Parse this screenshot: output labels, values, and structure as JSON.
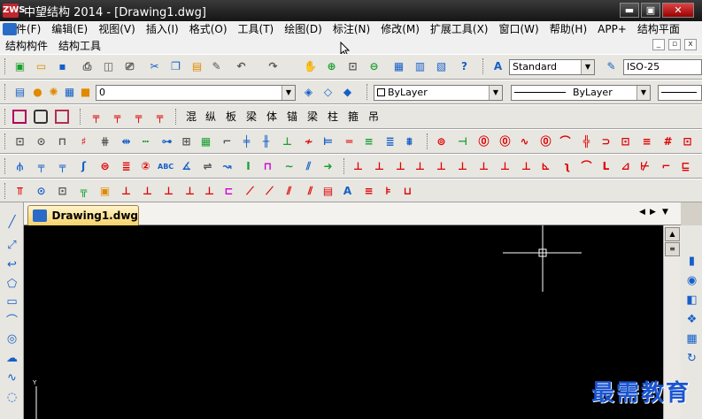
{
  "window": {
    "title": "中望结构 2014 - [Drawing1.dwg]",
    "logo_text": "ZWS",
    "min_label": "▬",
    "restore_label": "▣",
    "close_label": "✕"
  },
  "menubar": {
    "items": [
      "文件(F)",
      "编辑(E)",
      "视图(V)",
      "插入(I)",
      "格式(O)",
      "工具(T)",
      "绘图(D)",
      "标注(N)",
      "修改(M)",
      "扩展工具(X)",
      "窗口(W)",
      "帮助(H)",
      "APP+",
      "结构平面"
    ],
    "items2": [
      "结构构件",
      "结构工具"
    ]
  },
  "toolbar1": {
    "text_style": "Standard",
    "dim_style": "ISO-25"
  },
  "toolbar2": {
    "layer": "0",
    "color": "ByLayer",
    "linetype": "ByLayer"
  },
  "toolbar3": {
    "labels": [
      "混",
      "纵",
      "板",
      "梁",
      "体",
      "锚",
      "梁",
      "柱",
      "箍",
      "吊"
    ]
  },
  "document": {
    "tab_label": "Drawing1.dwg",
    "axis_y": "Y"
  },
  "watermark": "最需教育",
  "colors": {
    "canvas": "#000000",
    "titlebar": "#1e1e1e",
    "tab": "#f6d26a",
    "crosshair": "#ffffff"
  }
}
